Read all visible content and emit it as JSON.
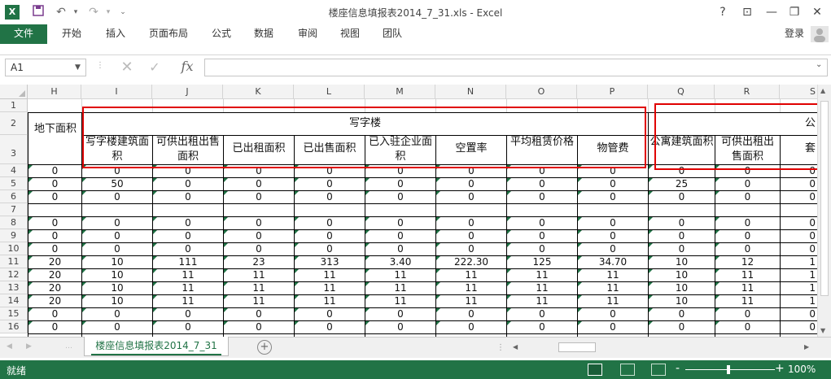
{
  "titlebar": {
    "title": "楼座信息填报表2014_7_31.xls - Excel",
    "app_icon": "X",
    "help": "?",
    "min": "—",
    "restore": "❐",
    "close": "✕"
  },
  "ribbon": {
    "tabs": [
      "文件",
      "开始",
      "插入",
      "页面布局",
      "公式",
      "数据",
      "审阅",
      "视图",
      "团队"
    ],
    "login": "登录"
  },
  "formula_bar": {
    "cell_ref": "A1",
    "fx": "fx",
    "value": ""
  },
  "columns": [
    "H",
    "I",
    "J",
    "K",
    "L",
    "M",
    "N",
    "O",
    "P",
    "Q",
    "R",
    "S"
  ],
  "rows": [
    "1",
    "2",
    "3",
    "4",
    "5",
    "6",
    "7",
    "8",
    "9",
    "10",
    "11",
    "12",
    "13",
    "14",
    "15",
    "16"
  ],
  "headers": {
    "office_group": "写字楼",
    "apartment_group": "公",
    "H": "地下面积",
    "I": "写字楼建筑面积",
    "J": "可供出租出售面积",
    "K": "已出租面积",
    "L": "已出售面积",
    "M": "已入驻企业面积",
    "N": "空置率",
    "O": "平均租赁价格",
    "P": "物管费",
    "Q": "公寓建筑面积",
    "R": "可供出租出售面积",
    "S": "套"
  },
  "data_rows": [
    [
      "0",
      "0",
      "0",
      "0",
      "0",
      "0",
      "0",
      "0",
      "0",
      "0",
      "0",
      "0"
    ],
    [
      "0",
      "50",
      "0",
      "0",
      "0",
      "0",
      "0",
      "0",
      "0",
      "25",
      "0",
      "0"
    ],
    [
      "0",
      "0",
      "0",
      "0",
      "0",
      "0",
      "0",
      "0",
      "0",
      "0",
      "0",
      "0"
    ],
    [
      "",
      "",
      "",
      "",
      "",
      "",
      "",
      "",
      "",
      "",
      "",
      ""
    ],
    [
      "0",
      "0",
      "0",
      "0",
      "0",
      "0",
      "0",
      "0",
      "0",
      "0",
      "0",
      "0"
    ],
    [
      "0",
      "0",
      "0",
      "0",
      "0",
      "0",
      "0",
      "0",
      "0",
      "0",
      "0",
      "0"
    ],
    [
      "0",
      "0",
      "0",
      "0",
      "0",
      "0",
      "0",
      "0",
      "0",
      "0",
      "0",
      "0"
    ],
    [
      "20",
      "10",
      "111",
      "23",
      "313",
      "3.40",
      "222.30",
      "125",
      "34.70",
      "10",
      "12",
      "1"
    ],
    [
      "20",
      "10",
      "11",
      "11",
      "11",
      "11",
      "11",
      "11",
      "11",
      "10",
      "11",
      "1"
    ],
    [
      "20",
      "10",
      "11",
      "11",
      "11",
      "11",
      "11",
      "11",
      "11",
      "10",
      "11",
      "1"
    ],
    [
      "20",
      "10",
      "11",
      "11",
      "11",
      "11",
      "11",
      "11",
      "11",
      "10",
      "11",
      "1"
    ],
    [
      "0",
      "0",
      "0",
      "0",
      "0",
      "0",
      "0",
      "0",
      "0",
      "0",
      "0",
      "0"
    ],
    [
      "0",
      "0",
      "0",
      "0",
      "0",
      "0",
      "0",
      "0",
      "0",
      "0",
      "0",
      "0"
    ]
  ],
  "sheet_tabs": {
    "active": "楼座信息填报表2014_7_31",
    "add": "+"
  },
  "statusbar": {
    "ready": "就绪",
    "zoom": "100%",
    "zoom_minus": "-",
    "zoom_plus": "+"
  },
  "colors": {
    "accent": "#217346",
    "highlight": "#e00000"
  }
}
